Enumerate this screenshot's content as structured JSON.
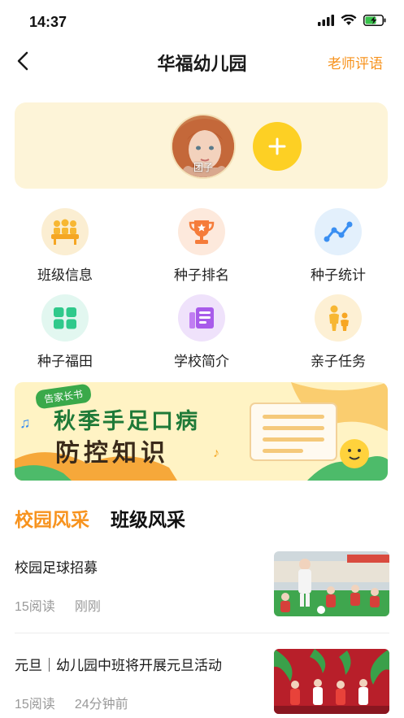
{
  "status_bar": {
    "time": "14:37"
  },
  "nav": {
    "title": "华福幼儿园",
    "action_label": "老师评语"
  },
  "child": {
    "name": "团子"
  },
  "grid": [
    {
      "label": "班级信息",
      "icon": "class-info-icon",
      "color": "#fbeed2"
    },
    {
      "label": "种子排名",
      "icon": "trophy-icon",
      "color": "#fde9dc"
    },
    {
      "label": "种子统计",
      "icon": "chart-icon",
      "color": "#e3f0fc"
    },
    {
      "label": "种子福田",
      "icon": "field-icon",
      "color": "#e2f7f0"
    },
    {
      "label": "学校简介",
      "icon": "school-intro-icon",
      "color": "#efe2fb"
    },
    {
      "label": "亲子任务",
      "icon": "parent-child-icon",
      "color": "#fdf0d4"
    }
  ],
  "banner": {
    "tag": "告家长书",
    "line1": "秋季手足口病",
    "line2": "防控知识"
  },
  "tabs": [
    {
      "label": "校园风采",
      "active": true
    },
    {
      "label": "班级风采",
      "active": false
    }
  ],
  "news": [
    {
      "title": "校园足球招募",
      "reads": "15阅读",
      "time": "刚刚"
    },
    {
      "title": "元旦｜幼儿园中班将开展元旦活动",
      "reads": "15阅读",
      "time": "24分钟前"
    }
  ],
  "colors": {
    "accent": "#f7931e",
    "add_button": "#fdd024",
    "card_bg": "#fdf4d8"
  }
}
